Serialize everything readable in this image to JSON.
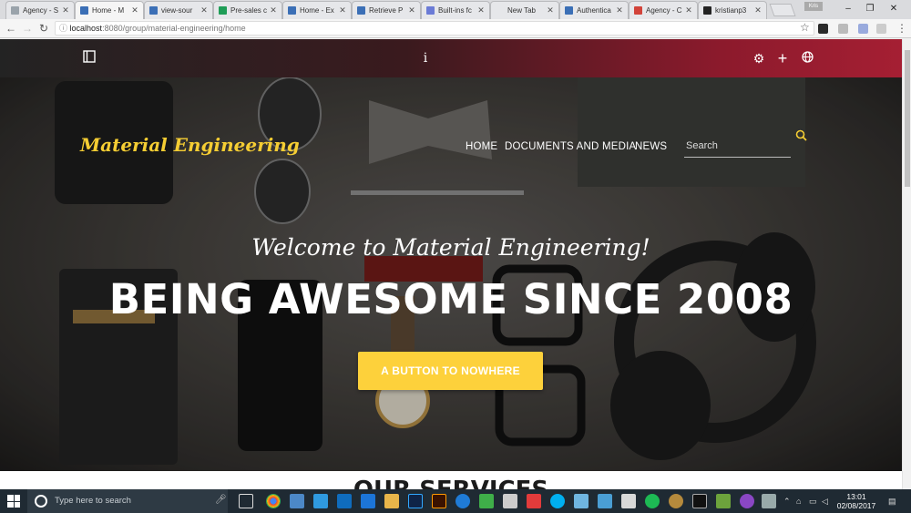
{
  "browser": {
    "tabs": [
      {
        "label": "Agency - S",
        "favicon_color": "#9aa3ab"
      },
      {
        "label": "Home - M",
        "favicon_color": "#3b6fb6"
      },
      {
        "label": "view-sour",
        "favicon_color": "#3b6fb6"
      },
      {
        "label": "Pre-sales c",
        "favicon_color": "#1f9d57"
      },
      {
        "label": "Home - Ex",
        "favicon_color": "#3b6fb6"
      },
      {
        "label": "Retrieve P",
        "favicon_color": "#3b6fb6"
      },
      {
        "label": "Built-ins fc",
        "favicon_color": "#6b7bd6"
      },
      {
        "label": "New Tab",
        "favicon_color": "#e6e7ea"
      },
      {
        "label": "Authentica",
        "favicon_color": "#3b6fb6"
      },
      {
        "label": "Agency - C",
        "favicon_color": "#d2433a"
      },
      {
        "label": "kristianp3",
        "favicon_color": "#222222"
      }
    ],
    "active_tab_index": 1,
    "profile_label": "Kris",
    "url_host": "localhost",
    "url_path": ":8080/group/material-engineering/home"
  },
  "site": {
    "logo": "Material Engineering",
    "nav": [
      "HOME",
      "DOCUMENTS AND MEDIA",
      "NEWS"
    ],
    "search_placeholder": "Search",
    "welcome": "Welcome to Material Engineering!",
    "headline": "BEING AWESOME SINCE 2008",
    "cta_label": "A BUTTON TO NOWHERE",
    "services_title": "OUR SERVICES",
    "accent_color": "#fdd13b",
    "control_menu_gradient": [
      "#232323",
      "#a51f33"
    ]
  },
  "taskbar": {
    "search_placeholder": "Type here to search",
    "time": "13:01",
    "date": "02/08/2017"
  }
}
